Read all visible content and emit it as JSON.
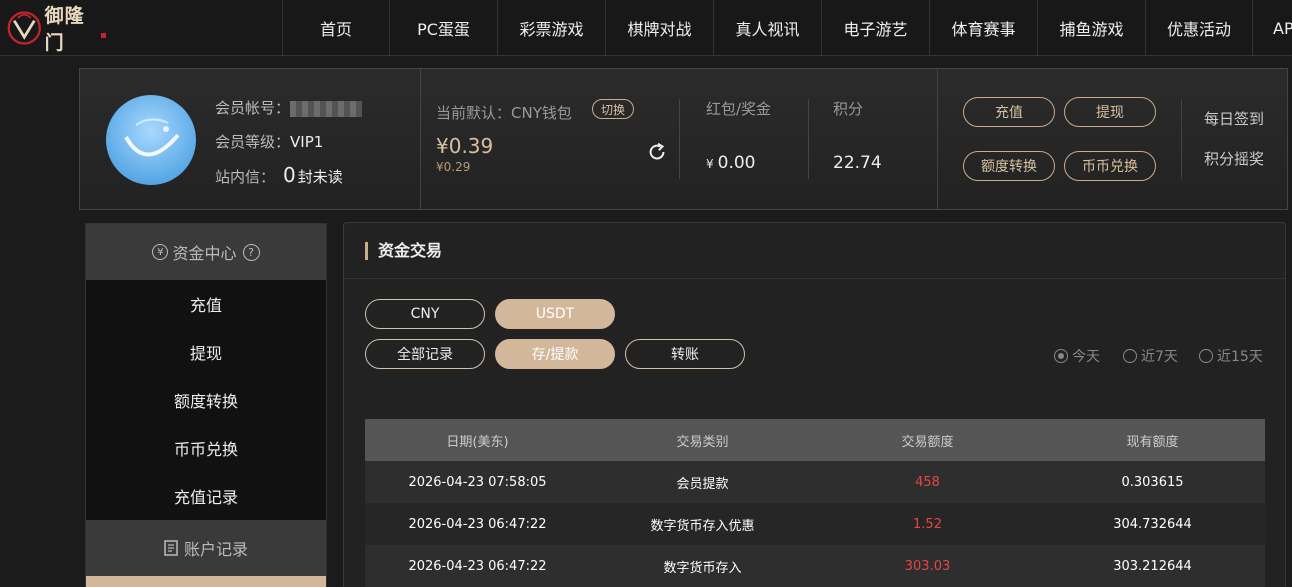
{
  "brand": {
    "logo_text": "御隆门"
  },
  "nav": {
    "items": [
      "首页",
      "PC蛋蛋",
      "彩票游戏",
      "棋牌对战",
      "真人视讯",
      "电子游艺",
      "体育赛事",
      "捕鱼游戏",
      "优惠活动",
      "AP"
    ]
  },
  "user": {
    "account_label": "会员帐号：",
    "level_label": "会员等级：",
    "level_value": "VIP1",
    "mail_label": "站内信：",
    "unread_count": "0",
    "unread_suffix": "封未读"
  },
  "wallet": {
    "label": "当前默认：CNY钱包",
    "switch_label": "切换",
    "balance": "¥0.39",
    "balance_sub": "¥0.29"
  },
  "bonus": {
    "label": "红包/奖金",
    "currency": "¥",
    "value": "0.00"
  },
  "points": {
    "label": "积分",
    "value": "22.74"
  },
  "actions": {
    "deposit": "充值",
    "withdraw": "提现",
    "transfer": "额度转换",
    "exchange": "币币兑换"
  },
  "links": {
    "checkin": "每日签到",
    "points_draw": "积分摇奖"
  },
  "sidebar": {
    "fund_center": "资金中心",
    "help_icon": "?",
    "items": [
      "充值",
      "提现",
      "额度转换",
      "币币兑换",
      "充值记录"
    ],
    "account_records": "账户记录"
  },
  "main": {
    "title": "资金交易",
    "currency_tabs": [
      "CNY",
      "USDT"
    ],
    "record_tabs": [
      "全部记录",
      "存/提款",
      "转账"
    ],
    "ranges": [
      "今天",
      "近7天",
      "近15天"
    ],
    "table": {
      "headers": [
        "日期(美东)",
        "交易类别",
        "交易额度",
        "现有额度"
      ],
      "rows": [
        [
          "2026-04-23 07:58:05",
          "会员提款",
          "458",
          "0.303615"
        ],
        [
          "2026-04-23 06:47:22",
          "数字货币存入优惠",
          "1.52",
          "304.732644"
        ],
        [
          "2026-04-23 06:47:22",
          "数字货币存入",
          "303.03",
          "303.212644"
        ]
      ]
    }
  },
  "colors": {
    "accent": "#d3b79a",
    "negative": "#e64545",
    "bg": "#1b1b1b"
  }
}
